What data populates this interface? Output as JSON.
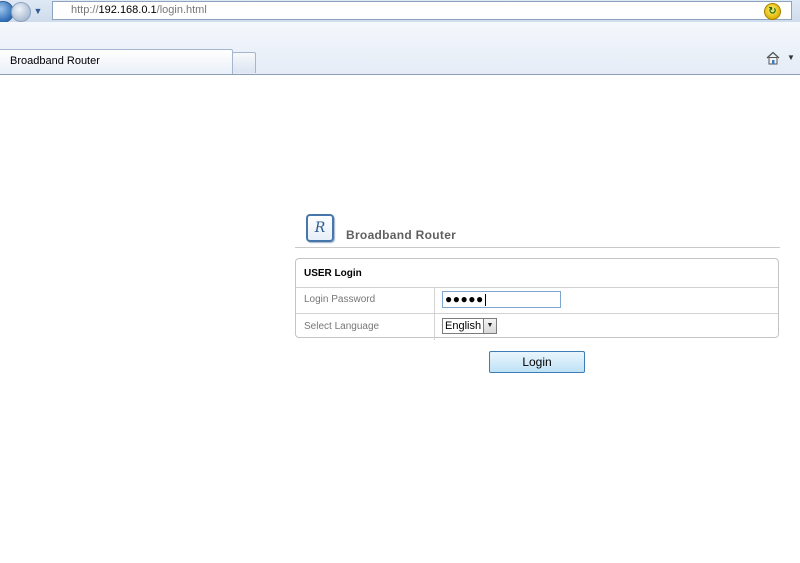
{
  "browser": {
    "url_prefix": "http://",
    "url_host": "192.168.0.1",
    "url_path": "/login.html",
    "tab_title": "Broadband Router"
  },
  "brand": {
    "logo_letter": "R",
    "title": "Broadband Router"
  },
  "login": {
    "header": "USER Login",
    "password_label": "Login Password",
    "password_value": "●●●●●",
    "language_label": "Select Language",
    "language_value": "English",
    "button_label": "Login"
  },
  "icons": {
    "back": "back-arrow-icon",
    "forward": "forward-arrow-icon",
    "refresh": "refresh-icon",
    "home": "home-icon"
  }
}
